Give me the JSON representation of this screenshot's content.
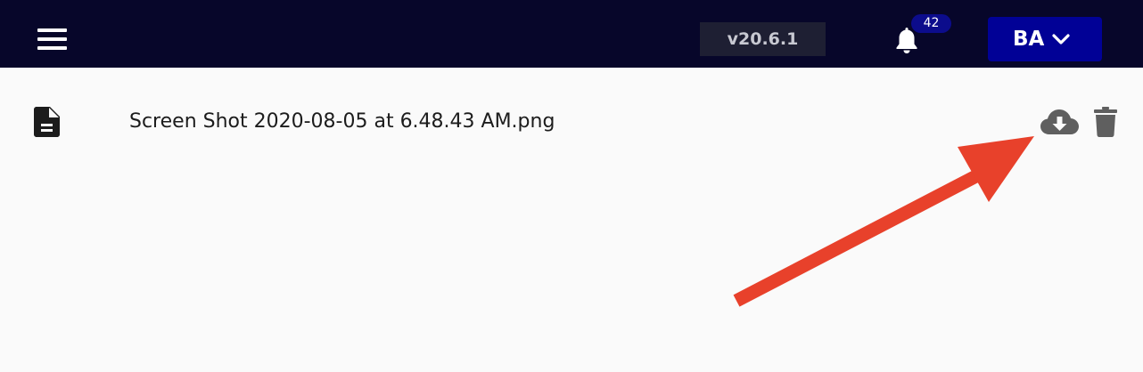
{
  "topbar": {
    "version": "v20.6.1",
    "notification_count": "42",
    "user_initials": "BA"
  },
  "file": {
    "name": "Screen Shot 2020-08-05 at 6.48.43 AM.png"
  },
  "icons": {
    "menu": "hamburger-menu-icon",
    "bell": "bell-icon",
    "chevron": "chevron-down-icon",
    "file": "document-icon",
    "download": "cloud-download-icon",
    "delete": "trash-icon"
  },
  "colors": {
    "topbar_bg": "#07062a",
    "version_bg": "#1e1f33",
    "badge_bg": "#0c0c8c",
    "user_button_bg": "#010196",
    "page_bg": "#fafafa",
    "action_icon": "#5f5f5f",
    "annotation_arrow": "#e8412b"
  }
}
